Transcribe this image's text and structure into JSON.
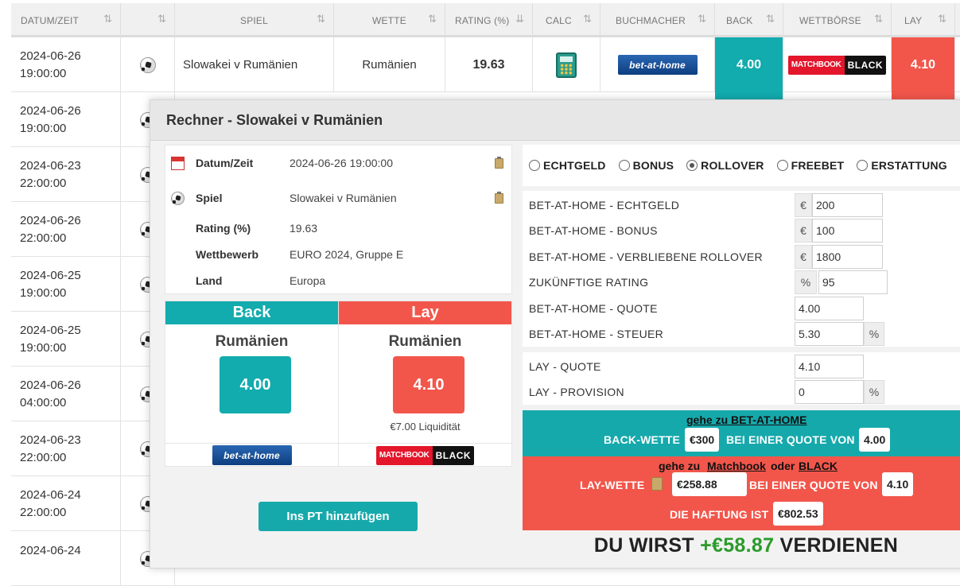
{
  "table": {
    "headers": [
      {
        "label": "DATUM/ZEIT"
      },
      {
        "label": ""
      },
      {
        "label": "SPIEL"
      },
      {
        "label": "WETTE"
      },
      {
        "label": "RATING (%)"
      },
      {
        "label": "CALC"
      },
      {
        "label": "BUCHMACHER"
      },
      {
        "label": "BACK"
      },
      {
        "label": "WETTBÖRSE"
      },
      {
        "label": "LAY"
      }
    ],
    "rows": [
      {
        "date": "2024-06-26",
        "time": "19:00:00",
        "game": "Slowakei v Rumänien",
        "bet": "Rumänien",
        "rating": "19.63",
        "back": "4.00",
        "lay": "4.10",
        "bookmaker_logo": "bet-at-home",
        "exchange_logo_red": "MATCHBOOK",
        "exchange_logo_black": "BLACK"
      },
      {
        "date": "2024-06-26",
        "time": "19:00:00"
      },
      {
        "date": "2024-06-23",
        "time": "22:00:00"
      },
      {
        "date": "2024-06-26",
        "time": "22:00:00"
      },
      {
        "date": "2024-06-25",
        "time": "19:00:00"
      },
      {
        "date": "2024-06-25",
        "time": "19:00:00"
      },
      {
        "date": "2024-06-26",
        "time": "04:00:00"
      },
      {
        "date": "2024-06-23",
        "time": "22:00:00"
      },
      {
        "date": "2024-06-24",
        "time": "22:00:00"
      },
      {
        "date": "2024-06-24",
        "time": ""
      }
    ]
  },
  "modal": {
    "title": "Rechner - Slowakei v Rumänien",
    "info": [
      {
        "key": "Datum/Zeit",
        "value": "2024-06-26 19:00:00",
        "icon": "calendar-icon"
      },
      {
        "key": "Spiel",
        "value": "Slowakei v Rumänien",
        "icon": "soccer-ball-icon"
      },
      {
        "key": "Rating (%)",
        "value": "19.63"
      },
      {
        "key": "Wettbewerb",
        "value": "EURO 2024, Gruppe E"
      },
      {
        "key": "Land",
        "value": "Europa"
      }
    ],
    "back": {
      "header": "Back",
      "team": "Rumänien",
      "odds": "4.00",
      "logo": "bet-at-home"
    },
    "lay": {
      "header": "Lay",
      "team": "Rumänien",
      "odds": "4.10",
      "liquidity": "€7.00 Liquidität",
      "logo_red": "MATCHBOOK",
      "logo_black": "BLACK"
    },
    "add_button": "Ins PT hinzufügen",
    "radios": [
      {
        "label": "ECHTGELD",
        "selected": false
      },
      {
        "label": "BONUS",
        "selected": false
      },
      {
        "label": "ROLLOVER",
        "selected": true
      },
      {
        "label": "FREEBET",
        "selected": false
      },
      {
        "label": "ERSTATTUNG",
        "selected": false
      }
    ],
    "fields": {
      "echtgeld": {
        "label": "BET-AT-HOME - ECHTGELD",
        "prefix": "€",
        "value": "200"
      },
      "bonus": {
        "label": "BET-AT-HOME - BONUS",
        "prefix": "€",
        "value": "100"
      },
      "rollover": {
        "label": "BET-AT-HOME - VERBLIEBENE ROLLOVER",
        "prefix": "€",
        "value": "1800"
      },
      "rating": {
        "label": "ZUKÜNFTIGE RATING",
        "prefix": "%",
        "value": "95"
      },
      "quote": {
        "label": "BET-AT-HOME - QUOTE",
        "value": "4.00"
      },
      "steuer": {
        "label": "BET-AT-HOME - STEUER",
        "value": "5.30",
        "suffix": "%"
      },
      "lay_quote": {
        "label": "LAY - QUOTE",
        "value": "4.10"
      },
      "lay_provision": {
        "label": "LAY - PROVISION",
        "value": "0",
        "suffix": "%"
      }
    },
    "back_result": {
      "link": "gehe zu BET-AT-HOME",
      "label": "BACK-WETTE",
      "stake": "€300",
      "at_odds": "BEI EINER QUOTE VON",
      "odds": "4.00"
    },
    "lay_result": {
      "link_prefix": "gehe zu",
      "link_matchbook": "Matchbook",
      "or": "oder",
      "link_black": "BLACK",
      "label": "LAY-WETTE",
      "stake": "€258.88",
      "at_odds": "BEI EINER QUOTE VON",
      "odds": "4.10",
      "liability_label": "DIE HAFTUNG IST",
      "liability": "€802.53"
    },
    "earn": {
      "prefix": "DU WIRST",
      "amount": "+€58.87",
      "suffix": "VERDIENEN"
    }
  },
  "colors": {
    "back": "#12abae",
    "lay": "#f2564b",
    "profit": "#2a9b2a"
  }
}
